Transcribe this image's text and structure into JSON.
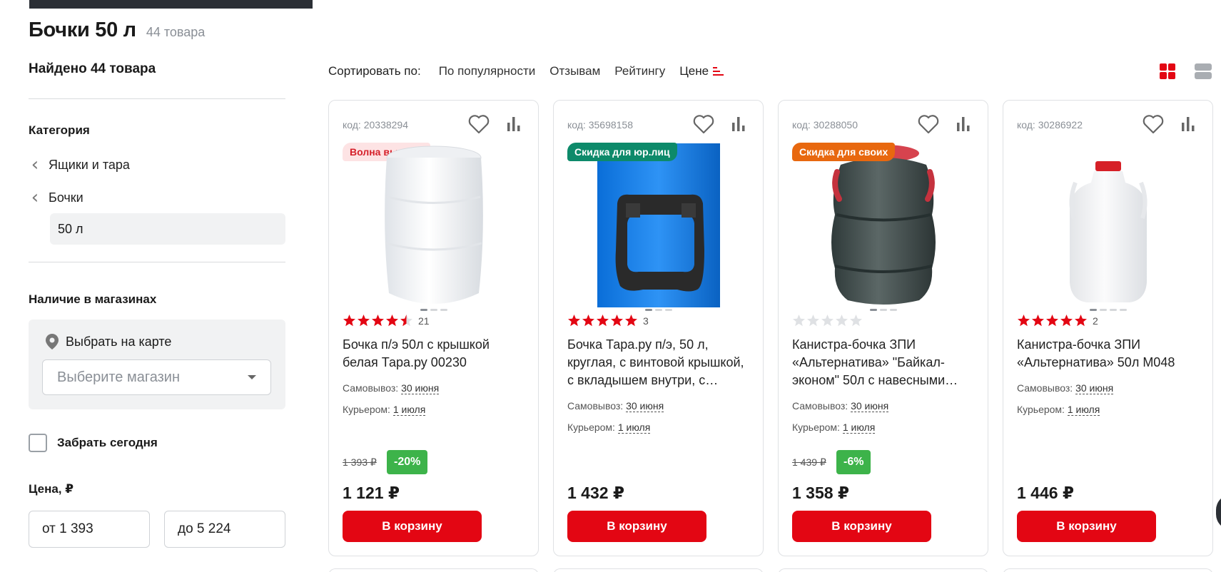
{
  "page": {
    "title": "Бочки 50 л",
    "count": "44 товара"
  },
  "sidebar": {
    "found": "Найдено 44 товара",
    "category": {
      "title": "Категория",
      "links": [
        "Ящики и тара",
        "Бочки"
      ],
      "current": "50 л"
    },
    "stores": {
      "title": "Наличие в магазинах",
      "pick_on_map": "Выбрать на карте",
      "select_placeholder": "Выберите магазин"
    },
    "pickup_today": "Забрать сегодня",
    "price": {
      "title": "Цена, ₽",
      "from": "от 1 393",
      "to": "до 5 224"
    }
  },
  "sort": {
    "label": "Сортировать по:",
    "options": [
      "По популярности",
      "Отзывам",
      "Рейтингу",
      "Цене"
    ]
  },
  "colors": {
    "accent": "#e30613",
    "badge_discount": "#3db34a"
  },
  "products": [
    {
      "code": "код: 20338294",
      "badge": "Волна выгоды",
      "rating": 4.5,
      "reviews": "21",
      "name": "Бочка п/э 50л с крышкой белая Тара.ру 00230",
      "pickup_label": "Самовывоз:",
      "pickup_date": "30 июня",
      "courier_label": "Курьером:",
      "courier_date": "1 июля",
      "old_price": "1 393 ₽",
      "discount": "-20%",
      "price": "1 121 ₽",
      "buy": "В корзину"
    },
    {
      "code": "код: 35698158",
      "badge": "Скидка для юр.лиц",
      "rating": 5,
      "reviews": "3",
      "name": "Бочка Тара.ру п/э, 50 л, круглая, с винтовой крышкой, с вкладышем внутри, с…",
      "pickup_label": "Самовывоз:",
      "pickup_date": "30 июня",
      "courier_label": "Курьером:",
      "courier_date": "1 июля",
      "old_price": "",
      "discount": "",
      "price": "1 432 ₽",
      "buy": "В корзину"
    },
    {
      "code": "код: 30288050",
      "badge": "Скидка для своих",
      "rating": 0,
      "reviews": "",
      "name": "Канистра-бочка ЗПИ «Альтернатива» \"Байкал-эконом\" 50л с навесными…",
      "pickup_label": "Самовывоз:",
      "pickup_date": "30 июня",
      "courier_label": "Курьером:",
      "courier_date": "1 июля",
      "old_price": "1 439 ₽",
      "discount": "-6%",
      "price": "1 358 ₽",
      "buy": "В корзину"
    },
    {
      "code": "код: 30286922",
      "badge": "",
      "rating": 5,
      "reviews": "2",
      "name": "Канистра-бочка ЗПИ «Альтернатива» 50л М048",
      "pickup_label": "Самовывоз:",
      "pickup_date": "30 июня",
      "courier_label": "Курьером:",
      "courier_date": "1 июля",
      "old_price": "",
      "discount": "",
      "price": "1 446 ₽",
      "buy": "В корзину"
    }
  ]
}
